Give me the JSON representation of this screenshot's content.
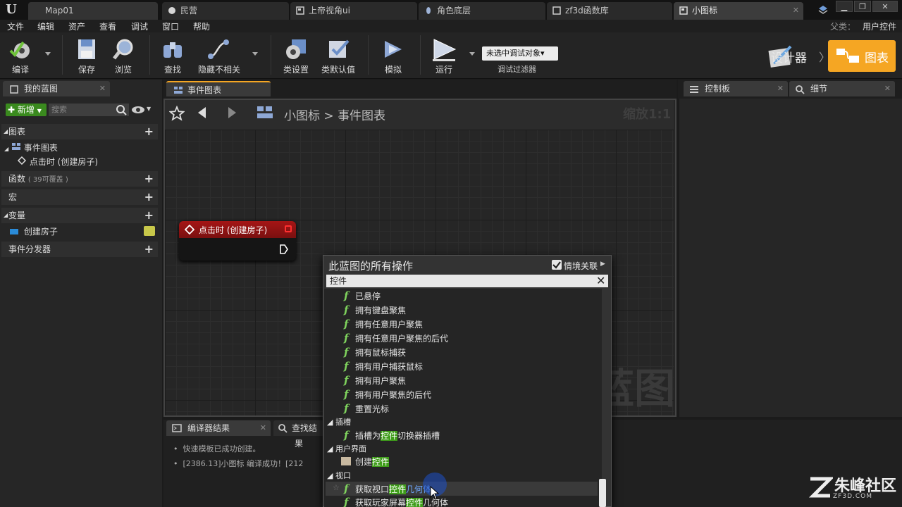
{
  "tabs": [
    {
      "label": "Map01",
      "icon": "map-icon"
    },
    {
      "label": "民营",
      "icon": "sphere-icon"
    },
    {
      "label": "上帝视角ui",
      "icon": "widget-icon"
    },
    {
      "label": "角色底层",
      "icon": "blueprint-icon"
    },
    {
      "label": "zf3d函数库",
      "icon": "function-library-icon"
    },
    {
      "label": "小图标",
      "icon": "widget-icon",
      "active": true
    }
  ],
  "menu": [
    "文件",
    "编辑",
    "资产",
    "查看",
    "调试",
    "窗口",
    "帮助"
  ],
  "parent": {
    "label": "父类：",
    "value": "用户控件"
  },
  "toolbar": {
    "compile": "编译",
    "save": "保存",
    "browse": "浏览",
    "find": "查找",
    "hide_unrelated": "隐藏不相关",
    "class_settings": "类设置",
    "class_defaults": "类默认值",
    "simulate": "模拟",
    "play": "运行",
    "debug_filter_value": "未选中调试对象▾",
    "debug_filter_caption": "调试过滤器",
    "designer": "设计器",
    "graph": "图表"
  },
  "left_panel": {
    "tab": "我的蓝图",
    "new_label": "新增",
    "search_placeholder": "搜索",
    "graphs": "图表",
    "event_graph": "事件图表",
    "event_item": "点击时 (创建房子)",
    "functions": "函数",
    "functions_note": "( 39可覆盖 )",
    "macros": "宏",
    "variables": "变量",
    "variable_item": "创建房子",
    "dispatchers": "事件分发器"
  },
  "graph": {
    "tab": "事件图表",
    "breadcrumb_root": "小图标",
    "breadcrumb_sep": ">",
    "breadcrumb_leaf": "事件图表",
    "zoom": "缩放1:1",
    "watermark": "蓝图",
    "node_title": "点击时 (创建房子)"
  },
  "right_panel": {
    "console_tab": "控制板",
    "details_tab": "细节"
  },
  "bottom": {
    "compiler_tab": "编译器结果",
    "find_tab": "查找结果",
    "log": [
      "快速模板已成功创建。",
      "[2386.13]小图标 编译成功！[212"
    ]
  },
  "action_menu": {
    "title": "此蓝图的所有操作",
    "context_label": "情境关联",
    "search_value": "控件",
    "items": [
      {
        "type": "fn",
        "pre": "已悬停",
        "hl": "",
        "post": ""
      },
      {
        "type": "fn",
        "pre": "拥有键盘聚焦",
        "hl": "",
        "post": ""
      },
      {
        "type": "fn",
        "pre": "拥有任意用户聚焦",
        "hl": "",
        "post": ""
      },
      {
        "type": "fn",
        "pre": "拥有任意用户聚焦的后代",
        "hl": "",
        "post": ""
      },
      {
        "type": "fn",
        "pre": "拥有鼠标捕获",
        "hl": "",
        "post": ""
      },
      {
        "type": "fn",
        "pre": "拥有用户捕获鼠标",
        "hl": "",
        "post": ""
      },
      {
        "type": "fn",
        "pre": "拥有用户聚焦",
        "hl": "",
        "post": ""
      },
      {
        "type": "fn",
        "pre": "拥有用户聚焦的后代",
        "hl": "",
        "post": ""
      },
      {
        "type": "fn",
        "pre": "重置光标",
        "hl": "",
        "post": ""
      },
      {
        "type": "cat",
        "label": "插槽"
      },
      {
        "type": "fn",
        "pre": "插槽为",
        "hl": "控件",
        "post": "切换器插槽"
      },
      {
        "type": "cat",
        "label": "用户界面"
      },
      {
        "type": "create",
        "pre": "创建",
        "hl": "控件",
        "post": ""
      },
      {
        "type": "cat",
        "label": "视口"
      },
      {
        "type": "fn",
        "pre": "获取视口",
        "hl": "控件",
        "post": "几何体"
      },
      {
        "type": "fn",
        "pre": "获取玩家屏幕",
        "hl": "控件",
        "post": "几何体"
      }
    ]
  },
  "corner_logo": {
    "title": "朱峰社区",
    "subtitle": "ZF3D.COM"
  }
}
